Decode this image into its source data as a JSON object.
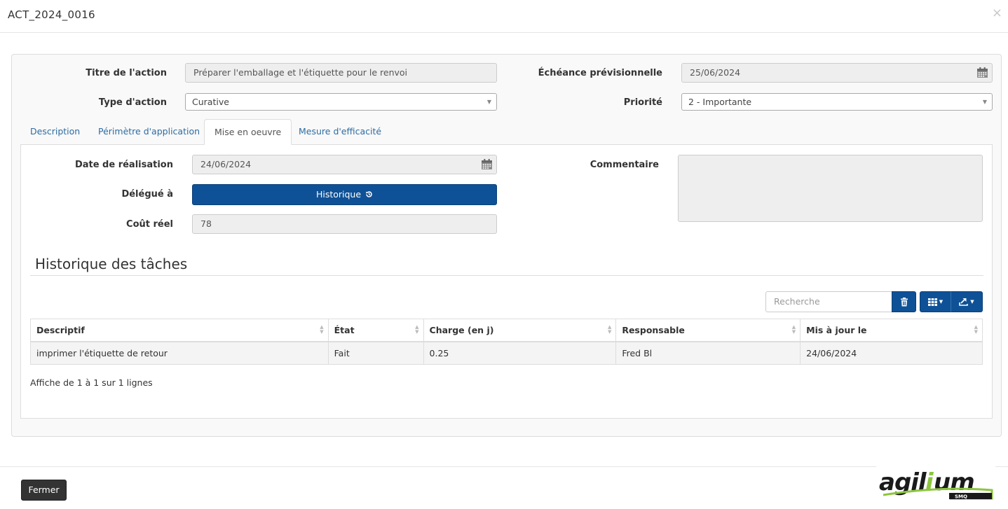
{
  "modal": {
    "title": "ACT_2024_0016",
    "close_glyph": "×"
  },
  "form": {
    "titre_label": "Titre de l'action",
    "titre_value": "Préparer l'emballage et l'étiquette pour le renvoi",
    "type_label": "Type d'action",
    "type_value": "Curative",
    "echeance_label": "Échéance prévisionnelle",
    "echeance_value": "25/06/2024",
    "priorite_label": "Priorité",
    "priorite_value": "2 - Importante"
  },
  "tabs": [
    {
      "label": "Description",
      "active": false
    },
    {
      "label": "Périmètre d'application",
      "active": false
    },
    {
      "label": "Mise en oeuvre",
      "active": true
    },
    {
      "label": "Mesure d'efficacité",
      "active": false
    }
  ],
  "mise_en_oeuvre": {
    "date_label": "Date de réalisation",
    "date_value": "24/06/2024",
    "delegue_label": "Délégué à",
    "historique_button": "Historique",
    "historique_icon": "history-icon",
    "cout_label": "Coût réel",
    "cout_value": "78",
    "commentaire_label": "Commentaire",
    "commentaire_value": ""
  },
  "historique": {
    "title": "Historique des tâches",
    "search_placeholder": "Recherche",
    "toolbar_icons": [
      "trash-icon",
      "columns-icon",
      "export-icon"
    ],
    "columns": [
      "Descriptif",
      "État",
      "Charge (en j)",
      "Responsable",
      "Mis à jour le"
    ],
    "rows": [
      [
        "imprimer l'étiquette de retour",
        "Fait",
        "0.25",
        "Fred Bl",
        "24/06/2024"
      ]
    ],
    "pagination_info": "Affiche de 1 à 1 sur 1 lignes"
  },
  "footer": {
    "close_button": "Fermer",
    "logo_text": "agilium",
    "logo_subtext": "SMQ"
  },
  "colors": {
    "primary": "#0f5196",
    "dark_button": "#333333",
    "link": "#2d6ca2",
    "logo_green": "#8cc63f"
  }
}
